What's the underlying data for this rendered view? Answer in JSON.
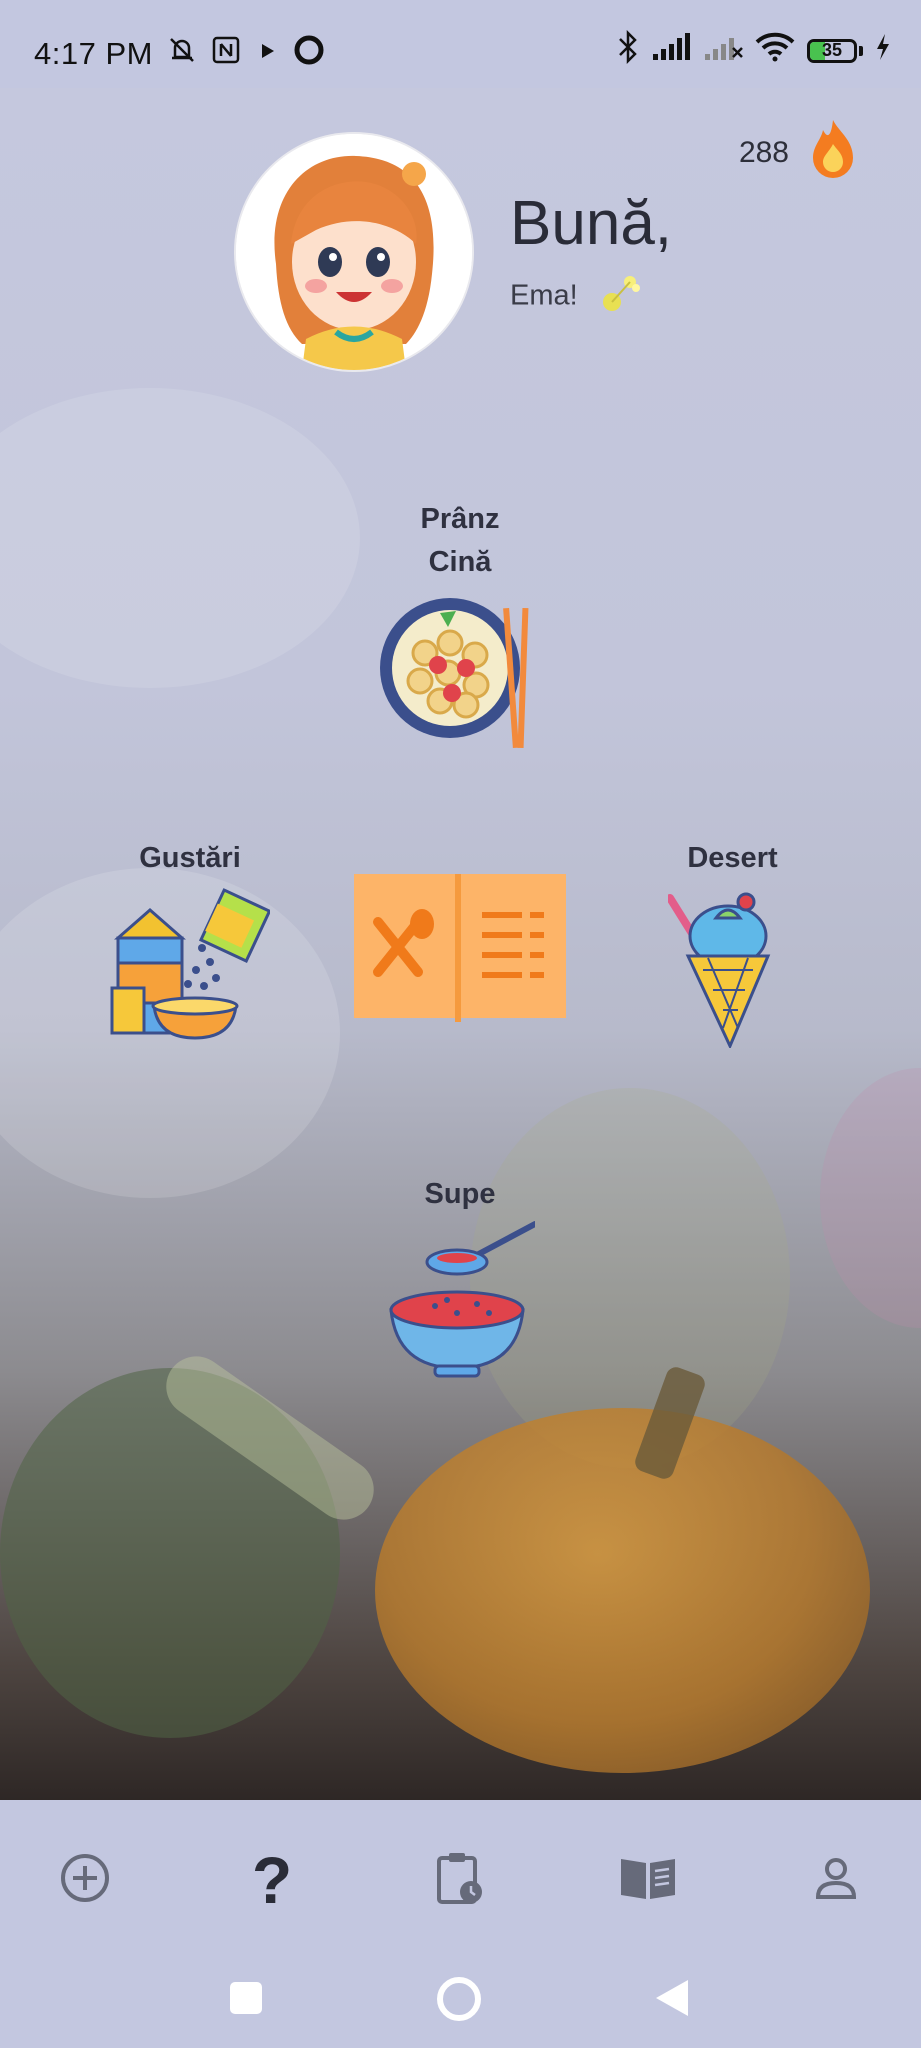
{
  "status_bar": {
    "time": "4:17 PM",
    "battery_level": "35",
    "battery_percent": 35,
    "icons": [
      "muted-bell-icon",
      "nfc-icon",
      "play-icon",
      "circle-icon",
      "bluetooth-icon",
      "signal-icon",
      "signal-off-icon",
      "wifi-icon",
      "battery-icon",
      "charging-icon"
    ]
  },
  "header": {
    "streak_count": "288",
    "streak_icon": "flame-icon",
    "greeting": "Bună,",
    "name": "Ema!"
  },
  "categories": {
    "top": {
      "line1": "Prânz",
      "line2": "Cină",
      "icon": "pasta-bowl-icon"
    },
    "left": {
      "label": "Gustări",
      "icon": "snacks-icon"
    },
    "center": {
      "icon": "menu-book-icon"
    },
    "right": {
      "label": "Desert",
      "icon": "ice-cream-icon"
    },
    "bottom": {
      "label": "Supe",
      "icon": "soup-bowl-icon"
    }
  },
  "bottom_nav": {
    "items": [
      {
        "icon": "add-circle-icon"
      },
      {
        "icon": "question-icon",
        "label": "?"
      },
      {
        "icon": "clipboard-clock-icon"
      },
      {
        "icon": "open-book-icon"
      },
      {
        "icon": "profile-icon"
      }
    ]
  },
  "system_nav": [
    "square-icon",
    "home-circle-icon",
    "back-triangle-icon"
  ],
  "colors": {
    "bar_bg": "#c3c7e0",
    "accent_orange": "#f7a440",
    "text_dark": "#2f3140"
  }
}
